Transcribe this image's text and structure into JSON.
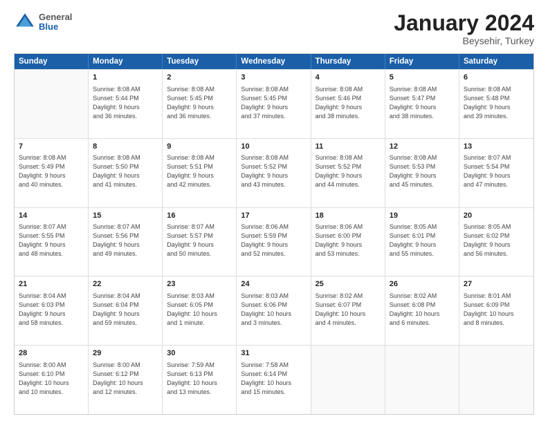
{
  "header": {
    "logo_general": "General",
    "logo_blue": "Blue",
    "month_title": "January 2024",
    "location": "Beysehir, Turkey"
  },
  "calendar": {
    "days_of_week": [
      "Sunday",
      "Monday",
      "Tuesday",
      "Wednesday",
      "Thursday",
      "Friday",
      "Saturday"
    ],
    "rows": [
      [
        {
          "day": "",
          "text": ""
        },
        {
          "day": "1",
          "text": "Sunrise: 8:08 AM\nSunset: 5:44 PM\nDaylight: 9 hours\nand 36 minutes."
        },
        {
          "day": "2",
          "text": "Sunrise: 8:08 AM\nSunset: 5:45 PM\nDaylight: 9 hours\nand 36 minutes."
        },
        {
          "day": "3",
          "text": "Sunrise: 8:08 AM\nSunset: 5:45 PM\nDaylight: 9 hours\nand 37 minutes."
        },
        {
          "day": "4",
          "text": "Sunrise: 8:08 AM\nSunset: 5:46 PM\nDaylight: 9 hours\nand 38 minutes."
        },
        {
          "day": "5",
          "text": "Sunrise: 8:08 AM\nSunset: 5:47 PM\nDaylight: 9 hours\nand 38 minutes."
        },
        {
          "day": "6",
          "text": "Sunrise: 8:08 AM\nSunset: 5:48 PM\nDaylight: 9 hours\nand 39 minutes."
        }
      ],
      [
        {
          "day": "7",
          "text": "Sunrise: 8:08 AM\nSunset: 5:49 PM\nDaylight: 9 hours\nand 40 minutes."
        },
        {
          "day": "8",
          "text": "Sunrise: 8:08 AM\nSunset: 5:50 PM\nDaylight: 9 hours\nand 41 minutes."
        },
        {
          "day": "9",
          "text": "Sunrise: 8:08 AM\nSunset: 5:51 PM\nDaylight: 9 hours\nand 42 minutes."
        },
        {
          "day": "10",
          "text": "Sunrise: 8:08 AM\nSunset: 5:52 PM\nDaylight: 9 hours\nand 43 minutes."
        },
        {
          "day": "11",
          "text": "Sunrise: 8:08 AM\nSunset: 5:52 PM\nDaylight: 9 hours\nand 44 minutes."
        },
        {
          "day": "12",
          "text": "Sunrise: 8:08 AM\nSunset: 5:53 PM\nDaylight: 9 hours\nand 45 minutes."
        },
        {
          "day": "13",
          "text": "Sunrise: 8:07 AM\nSunset: 5:54 PM\nDaylight: 9 hours\nand 47 minutes."
        }
      ],
      [
        {
          "day": "14",
          "text": "Sunrise: 8:07 AM\nSunset: 5:55 PM\nDaylight: 9 hours\nand 48 minutes."
        },
        {
          "day": "15",
          "text": "Sunrise: 8:07 AM\nSunset: 5:56 PM\nDaylight: 9 hours\nand 49 minutes."
        },
        {
          "day": "16",
          "text": "Sunrise: 8:07 AM\nSunset: 5:57 PM\nDaylight: 9 hours\nand 50 minutes."
        },
        {
          "day": "17",
          "text": "Sunrise: 8:06 AM\nSunset: 5:59 PM\nDaylight: 9 hours\nand 52 minutes."
        },
        {
          "day": "18",
          "text": "Sunrise: 8:06 AM\nSunset: 6:00 PM\nDaylight: 9 hours\nand 53 minutes."
        },
        {
          "day": "19",
          "text": "Sunrise: 8:05 AM\nSunset: 6:01 PM\nDaylight: 9 hours\nand 55 minutes."
        },
        {
          "day": "20",
          "text": "Sunrise: 8:05 AM\nSunset: 6:02 PM\nDaylight: 9 hours\nand 56 minutes."
        }
      ],
      [
        {
          "day": "21",
          "text": "Sunrise: 8:04 AM\nSunset: 6:03 PM\nDaylight: 9 hours\nand 58 minutes."
        },
        {
          "day": "22",
          "text": "Sunrise: 8:04 AM\nSunset: 6:04 PM\nDaylight: 9 hours\nand 59 minutes."
        },
        {
          "day": "23",
          "text": "Sunrise: 8:03 AM\nSunset: 6:05 PM\nDaylight: 10 hours\nand 1 minute."
        },
        {
          "day": "24",
          "text": "Sunrise: 8:03 AM\nSunset: 6:06 PM\nDaylight: 10 hours\nand 3 minutes."
        },
        {
          "day": "25",
          "text": "Sunrise: 8:02 AM\nSunset: 6:07 PM\nDaylight: 10 hours\nand 4 minutes."
        },
        {
          "day": "26",
          "text": "Sunrise: 8:02 AM\nSunset: 6:08 PM\nDaylight: 10 hours\nand 6 minutes."
        },
        {
          "day": "27",
          "text": "Sunrise: 8:01 AM\nSunset: 6:09 PM\nDaylight: 10 hours\nand 8 minutes."
        }
      ],
      [
        {
          "day": "28",
          "text": "Sunrise: 8:00 AM\nSunset: 6:10 PM\nDaylight: 10 hours\nand 10 minutes."
        },
        {
          "day": "29",
          "text": "Sunrise: 8:00 AM\nSunset: 6:12 PM\nDaylight: 10 hours\nand 12 minutes."
        },
        {
          "day": "30",
          "text": "Sunrise: 7:59 AM\nSunset: 6:13 PM\nDaylight: 10 hours\nand 13 minutes."
        },
        {
          "day": "31",
          "text": "Sunrise: 7:58 AM\nSunset: 6:14 PM\nDaylight: 10 hours\nand 15 minutes."
        },
        {
          "day": "",
          "text": ""
        },
        {
          "day": "",
          "text": ""
        },
        {
          "day": "",
          "text": ""
        }
      ]
    ]
  }
}
